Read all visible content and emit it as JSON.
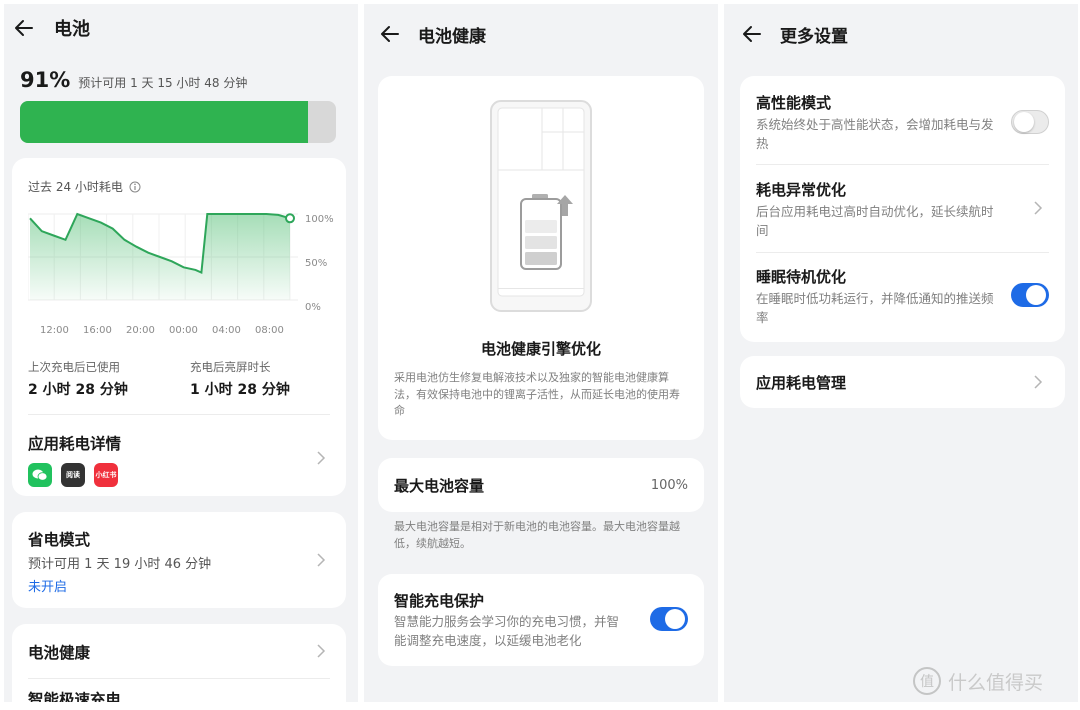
{
  "battery": {
    "title": "电池",
    "percent": "91%",
    "percent_value": 0.91,
    "estimate": "预计可用 1 天 15 小时 48 分钟",
    "chart_label": "过去 24 小时耗电",
    "chart_y_labels": [
      "100%",
      "50%",
      "0%"
    ],
    "chart_x_labels": [
      "12:00",
      "16:00",
      "20:00",
      "00:00",
      "04:00",
      "08:00"
    ],
    "since_charge_label": "上次充电后已使用",
    "since_charge_value": "2 小时 28 分钟",
    "screen_on_label": "充电后亮屏时长",
    "screen_on_value": "1 小时 28 分钟",
    "app_usage_label": "应用耗电详情",
    "app_icons": [
      {
        "name": "wechat-icon",
        "text": "",
        "color": "#21c25e"
      },
      {
        "name": "news-app-icon",
        "text": "阅读",
        "color": "#333333"
      },
      {
        "name": "xiaohongshu-icon",
        "text": "小红书",
        "color": "#f0303c"
      }
    ],
    "saver_title": "省电模式",
    "saver_estimate": "预计可用 1 天 19 小时 46 分钟",
    "saver_status": "未开启",
    "health_label": "电池健康",
    "fast_charge_label": "智能极速充电"
  },
  "health": {
    "title": "电池健康",
    "engine_title": "电池健康引擎优化",
    "engine_desc": "采用电池仿生修复电解液技术以及独家的智能电池健康算法，有效保持电池中的锂离子活性，从而延长电池的使用寿命",
    "max_capacity_label": "最大电池容量",
    "max_capacity_value": "100%",
    "capacity_note": "最大电池容量是相对于新电池的电池容量。最大电池容量越低，续航越短。",
    "smart_charge_title": "智能充电保护",
    "smart_charge_desc": "智慧能力服务会学习你的充电习惯，并智能调整充电速度，以延缓电池老化",
    "smart_charge_on": true
  },
  "more": {
    "title": "更多设置",
    "high_perf_title": "高性能模式",
    "high_perf_desc": "系统始终处于高性能状态，会增加耗电与发热",
    "high_perf_on": false,
    "abnormal_title": "耗电异常优化",
    "abnormal_desc": "后台应用耗电过高时自动优化，延长续航时间",
    "sleep_title": "睡眠待机优化",
    "sleep_desc": "在睡眠时低功耗运行，并降低通知的推送频率",
    "sleep_on": true,
    "app_power_label": "应用耗电管理"
  },
  "watermark": "什么值得买",
  "colors": {
    "battery_green": "#2fb350",
    "accent_blue": "#1e6be6",
    "chart_line": "#2ea65a"
  },
  "chart_data": {
    "type": "area",
    "x": [
      "12:00",
      "16:00",
      "20:00",
      "00:00",
      "04:00",
      "08:00"
    ],
    "series": [
      {
        "values": [
          [
            0,
            95
          ],
          [
            1,
            80
          ],
          [
            2,
            75
          ],
          [
            3,
            70
          ],
          [
            3.5,
            85
          ],
          [
            4,
            100
          ],
          [
            5,
            95
          ],
          [
            6,
            90
          ],
          [
            7,
            83
          ],
          [
            8,
            70
          ],
          [
            9,
            62
          ],
          [
            10,
            55
          ],
          [
            11,
            50
          ],
          [
            12,
            45
          ],
          [
            13,
            38
          ],
          [
            14,
            35
          ],
          [
            14.5,
            32
          ],
          [
            15,
            100
          ],
          [
            16,
            100
          ],
          [
            18,
            100
          ],
          [
            20,
            100
          ],
          [
            21,
            99
          ],
          [
            22,
            95
          ]
        ]
      }
    ],
    "xlim": [
      0,
      22
    ],
    "ylim": [
      0,
      100
    ],
    "y_ticks": [
      "100%",
      "50%",
      "0%"
    ],
    "grid": true
  }
}
